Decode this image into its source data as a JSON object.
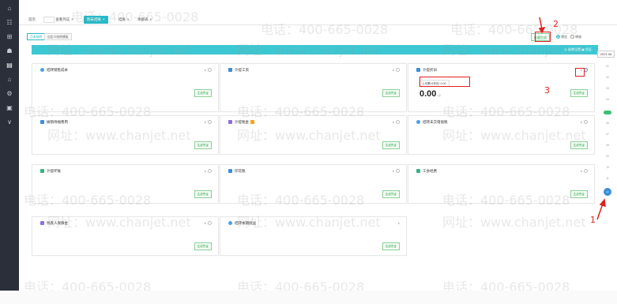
{
  "sidebar": {
    "items": [
      "⌂",
      "☷",
      "⊞",
      "☗",
      "▤",
      "⌂",
      "⚙",
      "▣",
      "∨"
    ]
  },
  "tabs": [
    {
      "label": "首页"
    },
    {
      "label": "查看凭证",
      "close": "×"
    },
    {
      "label": "期末结账",
      "close": "×"
    },
    {
      "label": "结账",
      "close": "×"
    },
    {
      "label": "余额表",
      "close": "×"
    }
  ],
  "subtabs": [
    "月末结转",
    "自定义结转模板"
  ],
  "toolbar": {
    "batch_label": "批量生成",
    "radio_preview": "预览",
    "radio_generate": "审核"
  },
  "banner": {
    "left_label": "",
    "right_label": "◎ 结转设置   ▣ 凭证",
    "date": "2021.06"
  },
  "cards": [
    {
      "title": "结转销售成本",
      "icon": "dot",
      "btn": "生成凭证"
    },
    {
      "title": "计提工资",
      "icon": "square",
      "btn": "生成凭证"
    },
    {
      "title": "计提折旧",
      "icon": "square",
      "btn": "生成凭证",
      "tooltip": "上月累计折旧: 0.00",
      "amount": "0.00"
    },
    {
      "title": "摊销待摊费用",
      "icon": "square",
      "btn": "生成凭证"
    },
    {
      "title": "计提税金",
      "icon": "purple",
      "btn": "生成凭证"
    },
    {
      "title": "结转未交增值税",
      "icon": "dot",
      "btn": "生成凭证"
    },
    {
      "title": "计提坏账",
      "icon": "green",
      "btn": "生成凭证"
    },
    {
      "title": "印花税",
      "icon": "square",
      "btn": "生成凭证"
    },
    {
      "title": "工会经费",
      "icon": "green",
      "btn": "生成凭证"
    },
    {
      "title": "残疾人保障金",
      "icon": "purple",
      "btn": "生成凭证"
    },
    {
      "title": "结转本期损益",
      "icon": "dot",
      "btn": "生成凭证"
    }
  ],
  "annotations": {
    "n1": "1",
    "n2": "2",
    "n3": "3"
  },
  "rail": [
    "01",
    "02",
    "03",
    "04",
    "05",
    "06",
    "07",
    "08",
    "09",
    "10",
    "11",
    "12"
  ],
  "watermark": {
    "phone": "电话：400-665-0028",
    "site": "网址：www.chanjet.net"
  }
}
